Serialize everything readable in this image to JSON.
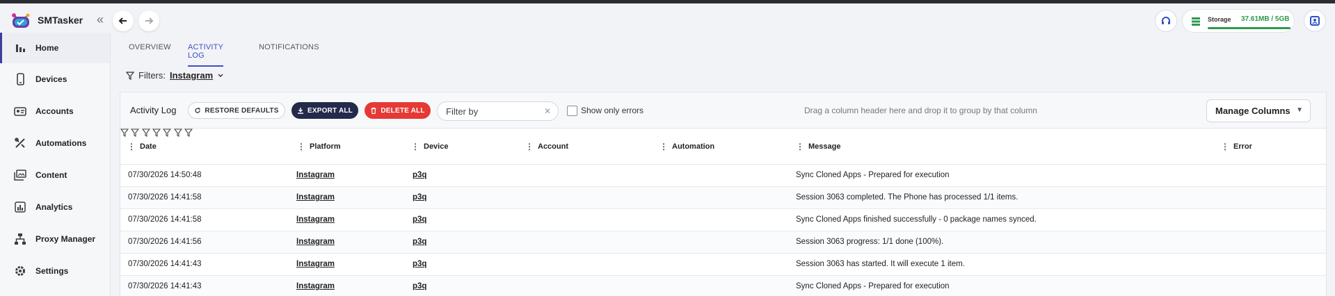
{
  "app": {
    "title": "SMTasker"
  },
  "storage": {
    "label": "Storage",
    "value": "37.61MB / 5GB",
    "fill_fraction": 0.99,
    "color": "#2e9a4c"
  },
  "sidebar": {
    "items": [
      {
        "label": "Home",
        "icon": "bar-chart-icon",
        "active": true
      },
      {
        "label": "Devices",
        "icon": "phone-icon"
      },
      {
        "label": "Accounts",
        "icon": "accounts-icon"
      },
      {
        "label": "Automations",
        "icon": "tools-icon"
      },
      {
        "label": "Content",
        "icon": "content-icon"
      },
      {
        "label": "Analytics",
        "icon": "analytics-icon"
      },
      {
        "label": "Proxy Manager",
        "icon": "network-icon"
      },
      {
        "label": "Settings",
        "icon": "gear-icon"
      }
    ]
  },
  "tabs": [
    {
      "label": "OVERVIEW"
    },
    {
      "label": "ACTIVITY LOG",
      "active": true
    },
    {
      "label": "NOTIFICATIONS"
    }
  ],
  "filters": {
    "label": "Filters:",
    "value": "Instagram"
  },
  "toolbar": {
    "title": "Activity Log",
    "restore_label": "RESTORE DEFAULTS",
    "export_label": "EXPORT ALL",
    "delete_label": "DELETE ALL",
    "filter_placeholder": "Filter by",
    "errors_label": "Show only errors",
    "drag_hint": "Drag a column header here and drop it to group by that column",
    "manage_label": "Manage Columns"
  },
  "table": {
    "columns": [
      "Date",
      "Platform",
      "Device",
      "Account",
      "Automation",
      "Message",
      "Error"
    ],
    "rows": [
      {
        "date": "07/30/2026 14:50:48",
        "platform": "Instagram",
        "device": "p3q",
        "account": "",
        "automation": "",
        "message": "Sync Cloned Apps - Prepared for execution",
        "error": ""
      },
      {
        "date": "07/30/2026 14:41:58",
        "platform": "Instagram",
        "device": "p3q",
        "account": "",
        "automation": "",
        "message": "Session 3063 completed. The Phone has processed 1/1 items.",
        "error": ""
      },
      {
        "date": "07/30/2026 14:41:58",
        "platform": "Instagram",
        "device": "p3q",
        "account": "",
        "automation": "",
        "message": "Sync Cloned Apps finished successfully - 0 package names synced.",
        "error": ""
      },
      {
        "date": "07/30/2026 14:41:56",
        "platform": "Instagram",
        "device": "p3q",
        "account": "",
        "automation": "",
        "message": "Session 3063 progress: 1/1 done (100%).",
        "error": ""
      },
      {
        "date": "07/30/2026 14:41:43",
        "platform": "Instagram",
        "device": "p3q",
        "account": "",
        "automation": "",
        "message": "Session 3063 has started. It will execute 1 item.",
        "error": ""
      },
      {
        "date": "07/30/2026 14:41:43",
        "platform": "Instagram",
        "device": "p3q",
        "account": "",
        "automation": "",
        "message": "Sync Cloned Apps - Prepared for execution",
        "error": ""
      }
    ]
  }
}
